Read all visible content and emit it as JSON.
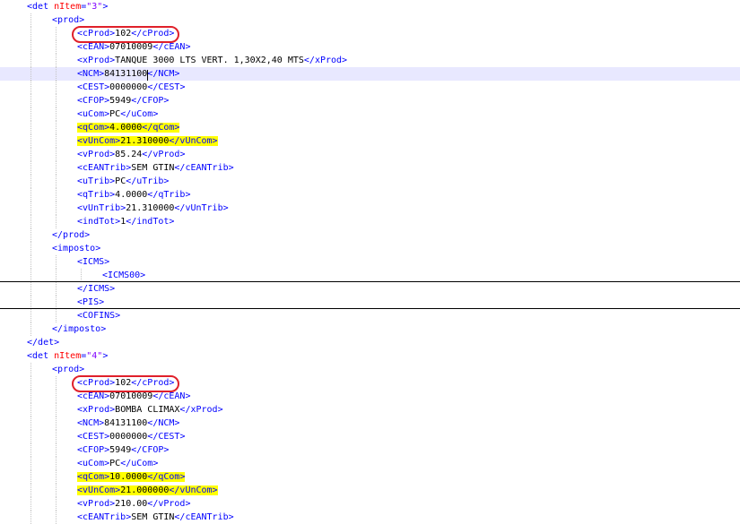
{
  "editor": {
    "lines": [
      {
        "indent": 0,
        "open": "det",
        "attr": "nItem",
        "value": "\"3\""
      },
      {
        "indent": 1,
        "open": "prod"
      },
      {
        "indent": 2,
        "open": "cProd",
        "text": "102",
        "close": "cProd",
        "circled": true
      },
      {
        "indent": 2,
        "open": "cEAN",
        "text": "07010009",
        "close": "cEAN"
      },
      {
        "indent": 2,
        "open": "xProd",
        "text": "TANQUE 3000 LTS VERT. 1,30X2,40 MTS",
        "close": "xProd"
      },
      {
        "indent": 2,
        "open": "NCM",
        "text": "84131100",
        "close": "NCM",
        "current": true
      },
      {
        "indent": 2,
        "open": "CEST",
        "text": "0000000",
        "close": "CEST"
      },
      {
        "indent": 2,
        "open": "CFOP",
        "text": "5949",
        "close": "CFOP"
      },
      {
        "indent": 2,
        "open": "uCom",
        "text": "PC",
        "close": "uCom"
      },
      {
        "indent": 2,
        "open": "qCom",
        "text": "4.0000",
        "close": "qCom",
        "highlight": true
      },
      {
        "indent": 2,
        "open": "vUnCom",
        "text": "21.310000",
        "close": "vUnCom",
        "highlight": true
      },
      {
        "indent": 2,
        "open": "vProd",
        "text": "85.24",
        "close": "vProd"
      },
      {
        "indent": 2,
        "open": "cEANTrib",
        "text": "SEM GTIN",
        "close": "cEANTrib"
      },
      {
        "indent": 2,
        "open": "uTrib",
        "text": "PC",
        "close": "uTrib"
      },
      {
        "indent": 2,
        "open": "qTrib",
        "text": "4.0000",
        "close": "qTrib"
      },
      {
        "indent": 2,
        "open": "vUnTrib",
        "text": "21.310000",
        "close": "vUnTrib"
      },
      {
        "indent": 2,
        "open": "indTot",
        "text": "1",
        "close": "indTot"
      },
      {
        "indent": 1,
        "close": "prod"
      },
      {
        "indent": 1,
        "open": "imposto"
      },
      {
        "indent": 2,
        "open": "ICMS"
      },
      {
        "indent": 3,
        "open": "ICMS00",
        "separator_after": true
      },
      {
        "indent": 2,
        "close": "ICMS"
      },
      {
        "indent": 2,
        "open": "PIS",
        "separator_after": true
      },
      {
        "indent": 2,
        "open": "COFINS"
      },
      {
        "indent": 1,
        "close": "imposto"
      },
      {
        "indent": 0,
        "close": "det"
      },
      {
        "indent": 0,
        "open": "det",
        "attr": "nItem",
        "value": "\"4\""
      },
      {
        "indent": 1,
        "open": "prod"
      },
      {
        "indent": 2,
        "open": "cProd",
        "text": "102",
        "close": "cProd",
        "circled": true
      },
      {
        "indent": 2,
        "open": "cEAN",
        "text": "07010009",
        "close": "cEAN"
      },
      {
        "indent": 2,
        "open": "xProd",
        "text": "BOMBA CLIMAX",
        "close": "xProd"
      },
      {
        "indent": 2,
        "open": "NCM",
        "text": "84131100",
        "close": "NCM"
      },
      {
        "indent": 2,
        "open": "CEST",
        "text": "0000000",
        "close": "CEST"
      },
      {
        "indent": 2,
        "open": "CFOP",
        "text": "5949",
        "close": "CFOP"
      },
      {
        "indent": 2,
        "open": "uCom",
        "text": "PC",
        "close": "uCom"
      },
      {
        "indent": 2,
        "open": "qCom",
        "text": "10.0000",
        "close": "qCom",
        "highlight": true
      },
      {
        "indent": 2,
        "open": "vUnCom",
        "text": "21.000000",
        "close": "vUnCom",
        "highlight": true
      },
      {
        "indent": 2,
        "open": "vProd",
        "text": "210.00",
        "close": "vProd"
      },
      {
        "indent": 2,
        "open": "cEANTrib",
        "text": "SEM GTIN",
        "close": "cEANTrib"
      }
    ]
  }
}
